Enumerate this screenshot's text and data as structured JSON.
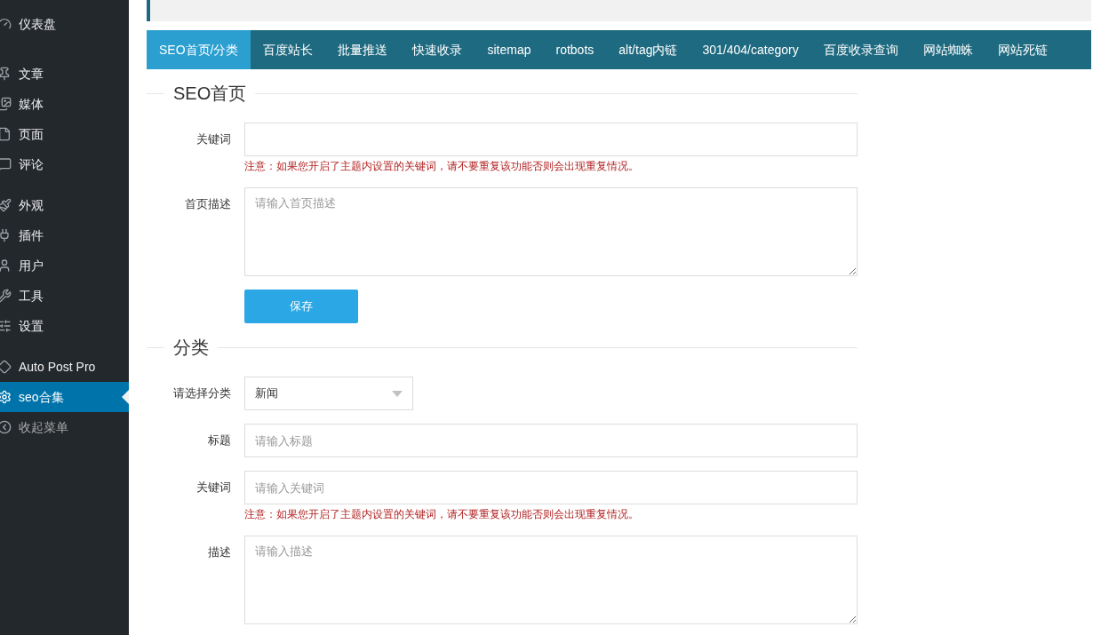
{
  "sidebar": {
    "groups": [
      [
        {
          "label": "仪表盘",
          "selected": false
        }
      ],
      [
        {
          "label": "文章",
          "selected": false
        },
        {
          "label": "媒体",
          "selected": false
        },
        {
          "label": "页面",
          "selected": false
        },
        {
          "label": "评论",
          "selected": false
        }
      ],
      [
        {
          "label": "外观",
          "selected": false
        },
        {
          "label": "插件",
          "selected": false
        },
        {
          "label": "用户",
          "selected": false
        },
        {
          "label": "工具",
          "selected": false
        },
        {
          "label": "设置",
          "selected": false
        }
      ],
      [
        {
          "label": "Auto Post Pro",
          "selected": false
        },
        {
          "label": "seo合集",
          "selected": true
        },
        {
          "label": "收起菜单",
          "selected": false,
          "kind": "collapse"
        }
      ]
    ]
  },
  "tabs": [
    {
      "label": "SEO首页/分类",
      "selected": true
    },
    {
      "label": "百度站长",
      "selected": false
    },
    {
      "label": "批量推送",
      "selected": false
    },
    {
      "label": "快速收录",
      "selected": false
    },
    {
      "label": "sitemap",
      "selected": false
    },
    {
      "label": "rotbots",
      "selected": false
    },
    {
      "label": "alt/tag内链",
      "selected": false
    },
    {
      "label": "301/404/category",
      "selected": false
    },
    {
      "label": "百度收录查询",
      "selected": false
    },
    {
      "label": "网站蜘蛛",
      "selected": false
    },
    {
      "label": "网站死链",
      "selected": false
    }
  ],
  "sections": [
    {
      "title": "SEO首页",
      "fields": [
        {
          "kind": "text",
          "label": "关键词",
          "note": "注意：如果您开启了主题内设置的关键词，请不要重复该功能否则会出现重复情况。"
        },
        {
          "kind": "textarea",
          "label": "首页描述",
          "placeholder": "请输入首页描述"
        }
      ],
      "button": "保存"
    },
    {
      "title": "分类",
      "fields": [
        {
          "kind": "select",
          "label": "请选择分类",
          "value": "新闻"
        },
        {
          "kind": "text",
          "label": "标题",
          "placeholder": "请输入标题"
        },
        {
          "kind": "text",
          "label": "关键词",
          "placeholder": "请输入关键词",
          "note": "注意：如果您开启了主题内设置的关键词，请不要重复该功能否则会出现重复情况。"
        },
        {
          "kind": "textarea",
          "label": "描述",
          "placeholder": "请输入描述"
        }
      ]
    }
  ]
}
